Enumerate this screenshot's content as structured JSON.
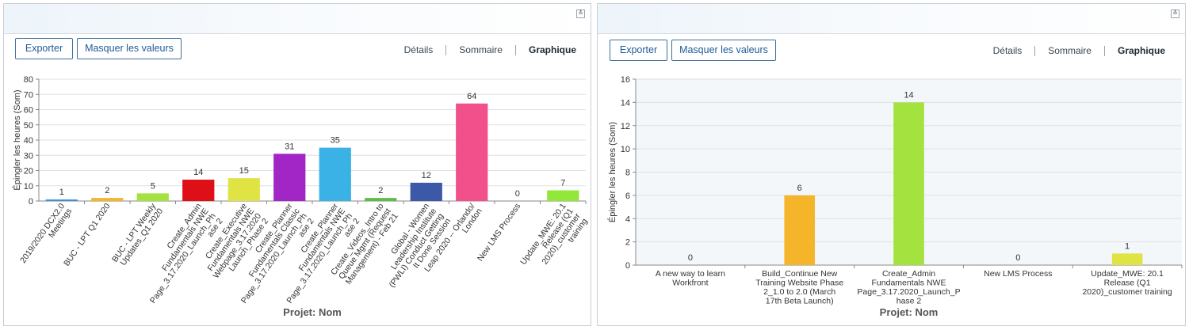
{
  "panels": [
    {
      "collapse_icon": "collapse-icon",
      "export_label": "Exporter",
      "hide_values_label": "Masquer les valeurs",
      "tabs": [
        {
          "label": "Détails",
          "active": false
        },
        {
          "label": "Sommaire",
          "active": false
        },
        {
          "label": "Graphique",
          "active": true
        }
      ]
    },
    {
      "collapse_icon": "collapse-icon",
      "export_label": "Exporter",
      "hide_values_label": "Masquer les valeurs",
      "tabs": [
        {
          "label": "Détails",
          "active": false
        },
        {
          "label": "Sommaire",
          "active": false
        },
        {
          "label": "Graphique",
          "active": true
        }
      ]
    }
  ],
  "chart_data": [
    {
      "type": "bar",
      "ylabel": "Épingler les heures (Som)",
      "xlabel": "Projet: Nom",
      "ylim": [
        0,
        80
      ],
      "yticks": [
        0,
        10,
        20,
        30,
        40,
        50,
        60,
        70,
        80
      ],
      "grid": true,
      "categories": [
        "2019/2020 DCX2.0 Meetings",
        "BUC - LPT Q1 2020",
        "BUC - LPT Weekly Updates_Q1 2020",
        "Create_Admin Fundamentals NWE Page_3.17.2020_Launch_Ph ase 2",
        "Create_Executive Fundamentals NWE Webpage_3.17.2020 Launch_Phase 2",
        "Create_Planner Fundamentals Classic Page_3.17.2020_Launch_Ph ase 2",
        "Create_Planner Fundamentals NWE Page_3.17.2020_Launch_Ph ase 2",
        "Create_Videos_Intro to Queue Mgmt (Request Management) - Feb 21",
        "Global - Women Leadership Institute (PWLI) Conduct Getting It Done Session",
        "Leap 2020 -- Orlando/ London",
        "New LMS Process",
        "Update_MWE: 20.1 Release (Q1 2020)_customer training"
      ],
      "values": [
        1,
        2,
        5,
        14,
        15,
        31,
        35,
        2,
        12,
        64,
        0,
        7
      ],
      "colors": [
        "#3a8fd9",
        "#f5b52a",
        "#a4e23f",
        "#de0f17",
        "#dfe344",
        "#a226c6",
        "#3ab2e6",
        "#5dbb46",
        "#3c58a8",
        "#f1508a",
        "#888888",
        "#92e83a"
      ]
    },
    {
      "type": "bar",
      "ylabel": "Épingler les heures (Som)",
      "xlabel": "Projet: Nom",
      "ylim": [
        0,
        16
      ],
      "yticks": [
        0,
        2,
        4,
        6,
        8,
        10,
        12,
        14,
        16
      ],
      "grid": true,
      "categories": [
        "A new way to learn Workfront",
        "Build_Continue New Training Website Phase 2_1.0 to 2.0 (March 17th Beta Launch)",
        "Create_Admin Fundamentals NWE Page_3.17.2020_Launch_P hase 2",
        "New LMS Process",
        "Update_MWE: 20.1 Release (Q1 2020)_customer training"
      ],
      "values": [
        0,
        6,
        14,
        0,
        1
      ],
      "colors": [
        "#888888",
        "#f5b52a",
        "#a4e23f",
        "#888888",
        "#dfe344"
      ]
    }
  ]
}
